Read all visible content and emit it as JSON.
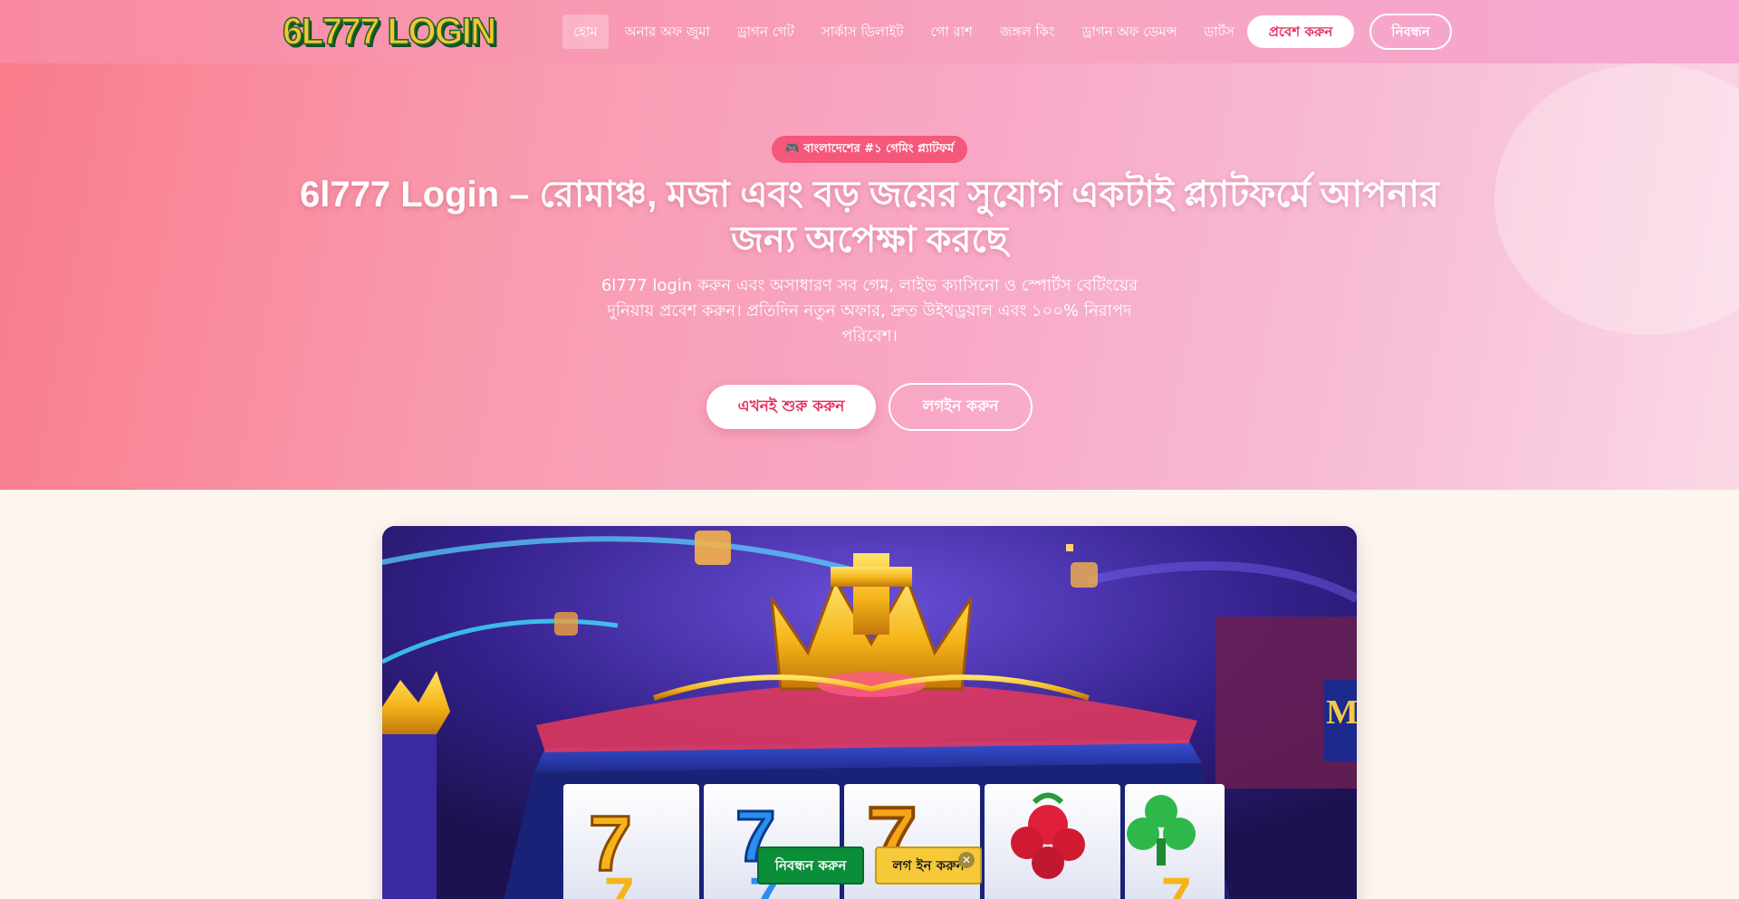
{
  "header": {
    "logo_text": "6L777 LOGIN",
    "nav": [
      {
        "label": "হোম",
        "active": true
      },
      {
        "label": "অনার অফ জুমা"
      },
      {
        "label": "ড্রাগন গেট"
      },
      {
        "label": "সার্কাস ডিলাইট"
      },
      {
        "label": "গো রাশ"
      },
      {
        "label": "জঙ্গল কিং"
      },
      {
        "label": "ড্রাগন অফ ডেমন্স"
      },
      {
        "label": "ডার্টস"
      }
    ],
    "login_label": "প্রবেশ করুন",
    "register_label": "নিবন্ধন"
  },
  "hero": {
    "badge": "🎮 বাংলাদেশের #১ গেমিং প্ল্যাটফর্ম",
    "title": "6l777 Login – রোমাঞ্চ, মজা এবং বড় জয়ের সুযোগ একটাই প্ল্যাটফর্মে আপনার জন্য অপেক্ষা করছে",
    "description": "6l777 login করুন এবং অসাধারণ সব গেম, লাইভ ক্যাসিনো ও স্পোর্টস বেটিংয়ের দুনিয়ায় প্রবেশ করুন। প্রতিদিন নতুন অফার, দ্রুত উইথড্রয়াল এবং ১০০% নিরাপদ পরিবেশ।",
    "start_label": "এখনই শুরু করুন",
    "login_label": "লগইন করুন"
  },
  "floating": {
    "register_label": "নিবন্ধন করুন",
    "login_label": "লগ ইন করুন",
    "close_glyph": "✕"
  },
  "colors": {
    "accent": "#e6315e",
    "badge": "#f5587a",
    "register_green": "#0b8e3a",
    "login_yellow": "#f6c93a",
    "page_bg": "#fdf6ee"
  }
}
